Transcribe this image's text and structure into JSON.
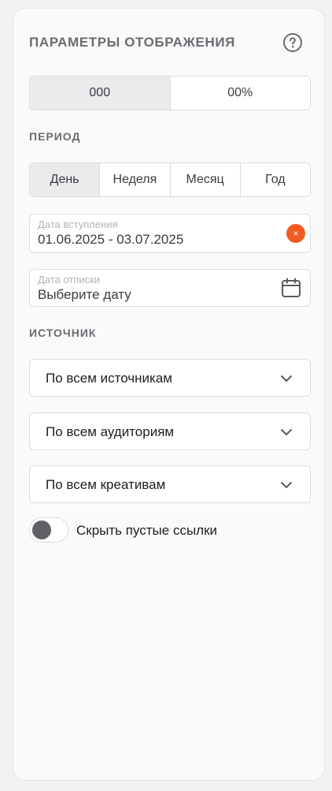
{
  "header": {
    "title": "ПАРАМЕТРЫ ОТОБРАЖЕНИЯ",
    "help_icon": "help-circle-icon"
  },
  "format_toggle": {
    "options": [
      "000",
      "00%"
    ],
    "selected": "000"
  },
  "period": {
    "label": "ПЕРИОД",
    "options": [
      "День",
      "Неделя",
      "Месяц",
      "Год"
    ],
    "selected": "День"
  },
  "join_date": {
    "label": "Дата вступления",
    "value": "01.06.2025 - 03.07.2025",
    "clear_glyph": "×",
    "clear_color": "#f15a22"
  },
  "unsubscribe_date": {
    "label": "Дата отписки",
    "placeholder": "Выберите дату",
    "icon": "calendar-icon"
  },
  "source": {
    "label": "ИСТОЧНИК",
    "selects": [
      {
        "value": "По всем источникам"
      },
      {
        "value": "По всем аудиториям"
      },
      {
        "value": "По всем креативам"
      }
    ]
  },
  "hide_empty": {
    "label": "Скрыть пустые ссылки",
    "on": false
  }
}
